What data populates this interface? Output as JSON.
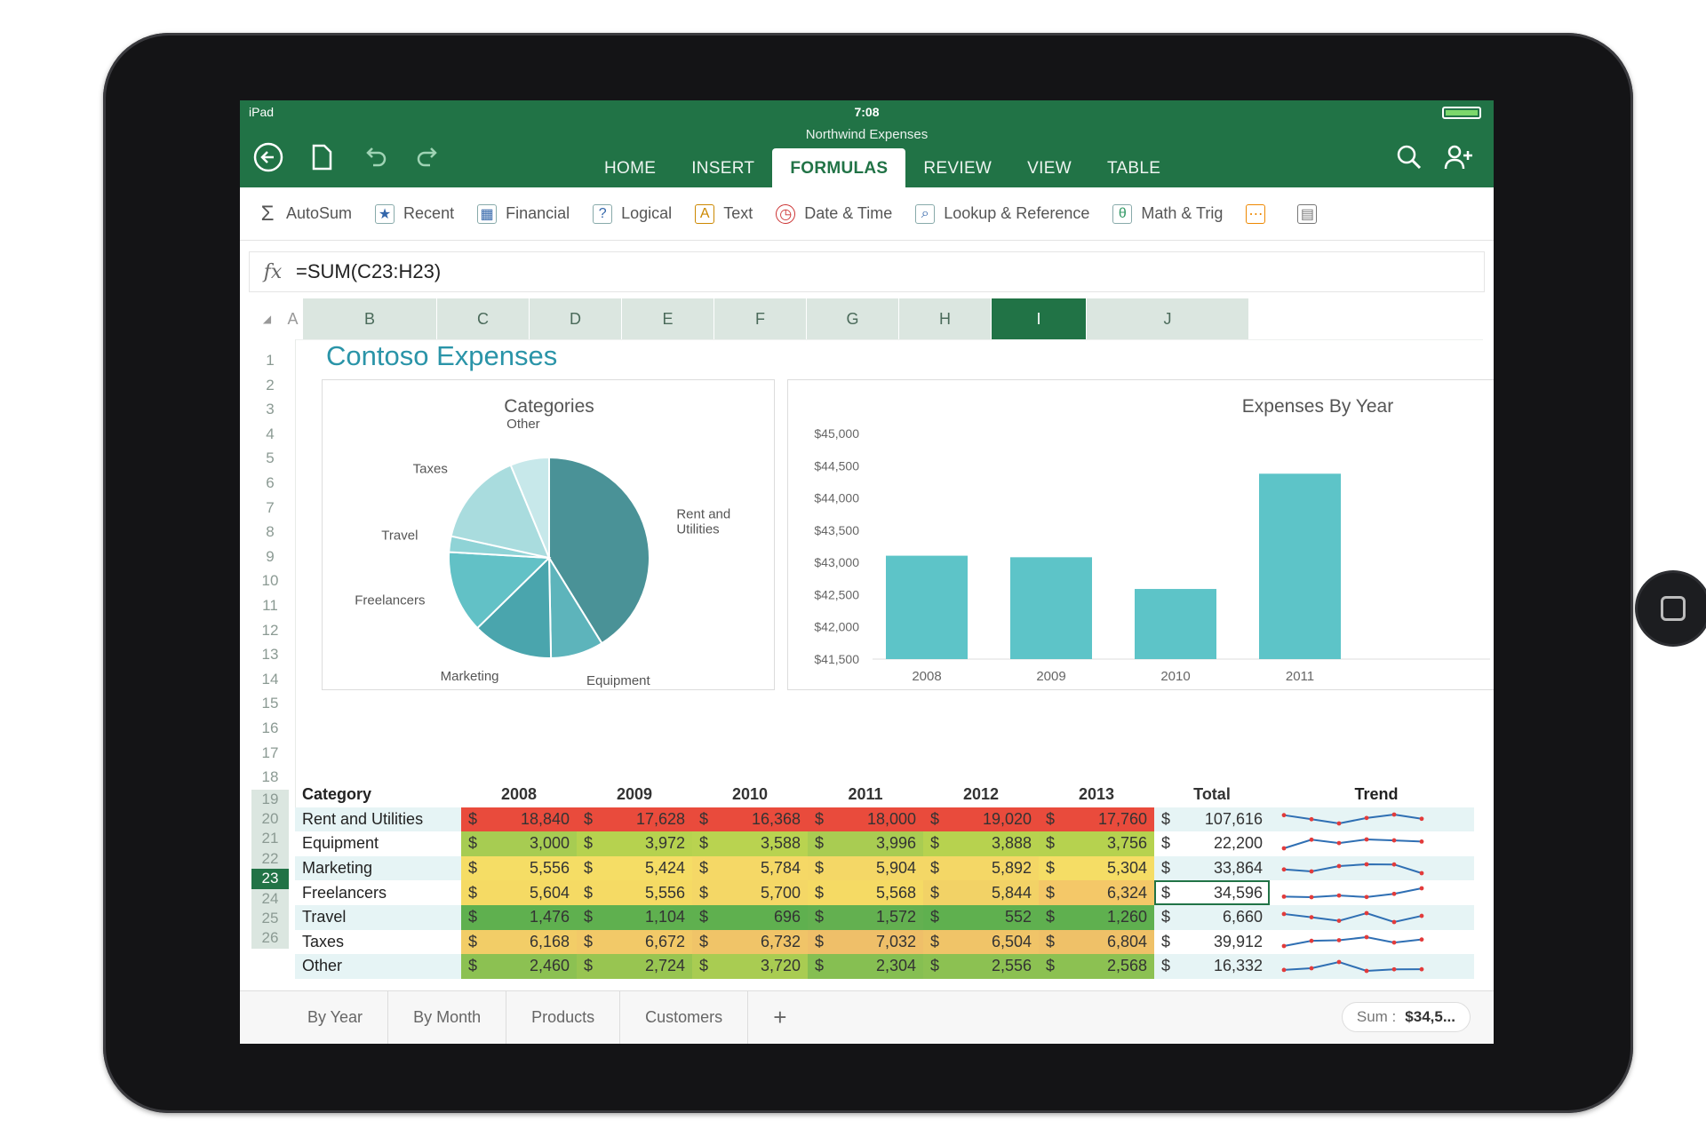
{
  "status": {
    "device": "iPad",
    "time": "7:08"
  },
  "doc_title": "Northwind Expenses",
  "ribbon_tabs": [
    "HOME",
    "INSERT",
    "FORMULAS",
    "REVIEW",
    "VIEW",
    "TABLE"
  ],
  "active_tab": "FORMULAS",
  "ribbon_items": [
    "AutoSum",
    "Recent",
    "Financial",
    "Logical",
    "Text",
    "Date & Time",
    "Lookup & Reference",
    "Math & Trig"
  ],
  "formula": {
    "fx": "fx",
    "value": "=SUM(C23:H23)"
  },
  "columns": [
    "A",
    "B",
    "C",
    "D",
    "E",
    "F",
    "G",
    "H",
    "I",
    "J"
  ],
  "selected_column": "I",
  "rows": [
    "1",
    "2",
    "3",
    "4",
    "5",
    "6",
    "7",
    "8",
    "9",
    "10",
    "11",
    "12",
    "13",
    "14",
    "15",
    "16",
    "17",
    "18",
    "19",
    "20",
    "21",
    "22",
    "23",
    "24",
    "25",
    "26"
  ],
  "selected_row": "23",
  "sheet_title": "Contoso Expenses",
  "chart_data": [
    {
      "type": "pie",
      "title": "Categories",
      "categories": [
        "Rent and Utilities",
        "Equipment",
        "Marketing",
        "Freelancers",
        "Travel",
        "Taxes",
        "Other"
      ],
      "values": [
        107616,
        22200,
        33864,
        34596,
        6660,
        39912,
        16332
      ],
      "colors": [
        "#4a9297",
        "#5db4bb",
        "#4aa5ad",
        "#62c1c6",
        "#8fd3d6",
        "#a9dcde",
        "#c7e8ea"
      ]
    },
    {
      "type": "bar",
      "title": "Expenses By Year",
      "categories": [
        "2008",
        "2009",
        "2010",
        "2011"
      ],
      "values": [
        43104,
        43080,
        42588,
        44376
      ],
      "ylim": [
        41500,
        45000
      ],
      "yticks": [
        "$41,500",
        "$42,000",
        "$42,500",
        "$43,000",
        "$43,500",
        "$44,000",
        "$44,500",
        "$45,000"
      ],
      "grid": false,
      "color": "#5dc4c8"
    }
  ],
  "table": {
    "headers": [
      "Category",
      "2008",
      "2009",
      "2010",
      "2011",
      "2012",
      "2013",
      "Total",
      "Trend"
    ],
    "currency": "$",
    "rows": [
      {
        "category": "Rent and Utilities",
        "values": [
          "18,840",
          "17,628",
          "16,368",
          "18,000",
          "19,020",
          "17,760"
        ],
        "total": "107,616"
      },
      {
        "category": "Equipment",
        "values": [
          "3,000",
          "3,972",
          "3,588",
          "3,996",
          "3,888",
          "3,756"
        ],
        "total": "22,200"
      },
      {
        "category": "Marketing",
        "values": [
          "5,556",
          "5,424",
          "5,784",
          "5,904",
          "5,892",
          "5,304"
        ],
        "total": "33,864"
      },
      {
        "category": "Freelancers",
        "values": [
          "5,604",
          "5,556",
          "5,700",
          "5,568",
          "5,844",
          "6,324"
        ],
        "total": "34,596"
      },
      {
        "category": "Travel",
        "values": [
          "1,476",
          "1,104",
          "696",
          "1,572",
          "552",
          "1,260"
        ],
        "total": "6,660"
      },
      {
        "category": "Taxes",
        "values": [
          "6,168",
          "6,672",
          "6,732",
          "7,032",
          "6,504",
          "6,804"
        ],
        "total": "39,912"
      },
      {
        "category": "Other",
        "values": [
          "2,460",
          "2,724",
          "3,720",
          "2,304",
          "2,556",
          "2,568"
        ],
        "total": "16,332"
      }
    ],
    "heat_colors": [
      [
        "#e94b3c",
        "#e94b3c",
        "#e94b3c",
        "#e94b3c",
        "#e94b3c",
        "#e94b3c"
      ],
      [
        "#a7cc52",
        "#b6d24f",
        "#b9d350",
        "#a9cc52",
        "#b7d24f",
        "#b6d24f"
      ],
      [
        "#f5dd65",
        "#f5dd65",
        "#f5d866",
        "#f4d766",
        "#f4d766",
        "#f5dd65"
      ],
      [
        "#f5da64",
        "#f5da64",
        "#f4d766",
        "#f5da64",
        "#f2d266",
        "#f4c868"
      ],
      [
        "#5fb04f",
        "#5fb04f",
        "#5fb04f",
        "#63b050",
        "#5fb04f",
        "#5fb04f"
      ],
      [
        "#f2cd67",
        "#f2c968",
        "#f0c468",
        "#efbf69",
        "#f0c468",
        "#efc168"
      ],
      [
        "#8cc152",
        "#98c551",
        "#a9cc52",
        "#86bf52",
        "#8cc152",
        "#8cc152"
      ]
    ]
  },
  "sheet_tabs": [
    "By Year",
    "By Month",
    "Products",
    "Customers"
  ],
  "active_sheet": "By Year",
  "add_sheet": "+",
  "sum_label": "Sum :",
  "sum_value": "$34,5..."
}
